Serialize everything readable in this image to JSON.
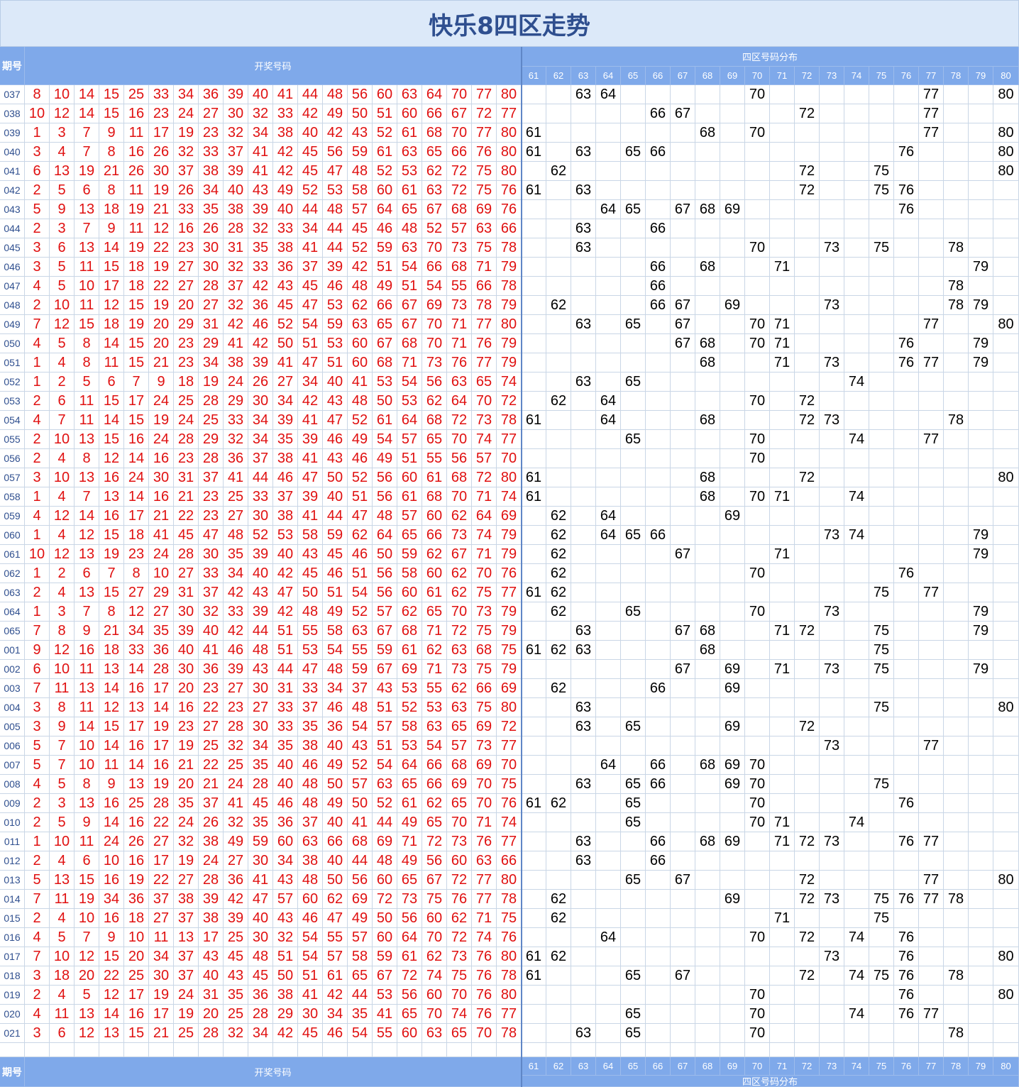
{
  "title": "快乐8四区走势",
  "header": {
    "issue_label": "期号",
    "draw_label": "开奖号码",
    "zone_label": "四区号码分布",
    "zone_numbers": [
      "61",
      "62",
      "63",
      "64",
      "65",
      "66",
      "67",
      "68",
      "69",
      "70",
      "71",
      "72",
      "73",
      "74",
      "75",
      "76",
      "77",
      "78",
      "79",
      "80"
    ]
  },
  "chart_data": {
    "type": "table",
    "columns": [
      "期号",
      "开奖号码",
      "四区号码分布"
    ],
    "rows": [
      {
        "issue": "037",
        "numbers": [
          "8",
          "10",
          "14",
          "15",
          "25",
          "33",
          "34",
          "36",
          "39",
          "40",
          "41",
          "44",
          "48",
          "56",
          "60",
          "63",
          "64",
          "70",
          "77",
          "80"
        ]
      },
      {
        "issue": "038",
        "numbers": [
          "10",
          "12",
          "14",
          "15",
          "16",
          "23",
          "24",
          "27",
          "30",
          "32",
          "33",
          "42",
          "49",
          "50",
          "51",
          "60",
          "66",
          "67",
          "72",
          "77"
        ]
      },
      {
        "issue": "039",
        "numbers": [
          "1",
          "3",
          "7",
          "9",
          "11",
          "17",
          "19",
          "23",
          "32",
          "34",
          "38",
          "40",
          "42",
          "43",
          "52",
          "61",
          "68",
          "70",
          "77",
          "80"
        ]
      },
      {
        "issue": "040",
        "numbers": [
          "3",
          "4",
          "7",
          "8",
          "16",
          "26",
          "32",
          "33",
          "37",
          "41",
          "42",
          "45",
          "56",
          "59",
          "61",
          "63",
          "65",
          "66",
          "76",
          "80"
        ]
      },
      {
        "issue": "041",
        "numbers": [
          "6",
          "13",
          "19",
          "21",
          "26",
          "30",
          "37",
          "38",
          "39",
          "41",
          "42",
          "45",
          "47",
          "48",
          "52",
          "53",
          "62",
          "72",
          "75",
          "80"
        ]
      },
      {
        "issue": "042",
        "numbers": [
          "2",
          "5",
          "6",
          "8",
          "11",
          "19",
          "26",
          "34",
          "40",
          "43",
          "49",
          "52",
          "53",
          "58",
          "60",
          "61",
          "63",
          "72",
          "75",
          "76"
        ]
      },
      {
        "issue": "043",
        "numbers": [
          "5",
          "9",
          "13",
          "18",
          "19",
          "21",
          "33",
          "35",
          "38",
          "39",
          "40",
          "44",
          "48",
          "57",
          "64",
          "65",
          "67",
          "68",
          "69",
          "76"
        ]
      },
      {
        "issue": "044",
        "numbers": [
          "2",
          "3",
          "7",
          "9",
          "11",
          "12",
          "16",
          "26",
          "28",
          "32",
          "33",
          "34",
          "44",
          "45",
          "46",
          "48",
          "52",
          "57",
          "63",
          "66"
        ]
      },
      {
        "issue": "045",
        "numbers": [
          "3",
          "6",
          "13",
          "14",
          "19",
          "22",
          "23",
          "30",
          "31",
          "35",
          "38",
          "41",
          "44",
          "52",
          "59",
          "63",
          "70",
          "73",
          "75",
          "78"
        ]
      },
      {
        "issue": "046",
        "numbers": [
          "3",
          "5",
          "11",
          "15",
          "18",
          "19",
          "27",
          "30",
          "32",
          "33",
          "36",
          "37",
          "39",
          "42",
          "51",
          "54",
          "66",
          "68",
          "71",
          "79"
        ]
      },
      {
        "issue": "047",
        "numbers": [
          "4",
          "5",
          "10",
          "17",
          "18",
          "22",
          "27",
          "28",
          "37",
          "42",
          "43",
          "45",
          "46",
          "48",
          "49",
          "51",
          "54",
          "55",
          "66",
          "78"
        ]
      },
      {
        "issue": "048",
        "numbers": [
          "2",
          "10",
          "11",
          "12",
          "15",
          "19",
          "20",
          "27",
          "32",
          "36",
          "45",
          "47",
          "53",
          "62",
          "66",
          "67",
          "69",
          "73",
          "78",
          "79"
        ]
      },
      {
        "issue": "049",
        "numbers": [
          "7",
          "12",
          "15",
          "18",
          "19",
          "20",
          "29",
          "31",
          "42",
          "46",
          "52",
          "54",
          "59",
          "63",
          "65",
          "67",
          "70",
          "71",
          "77",
          "80"
        ]
      },
      {
        "issue": "050",
        "numbers": [
          "4",
          "5",
          "8",
          "14",
          "15",
          "20",
          "23",
          "29",
          "41",
          "42",
          "50",
          "51",
          "53",
          "60",
          "67",
          "68",
          "70",
          "71",
          "76",
          "79"
        ]
      },
      {
        "issue": "051",
        "numbers": [
          "1",
          "4",
          "8",
          "11",
          "15",
          "21",
          "23",
          "34",
          "38",
          "39",
          "41",
          "47",
          "51",
          "60",
          "68",
          "71",
          "73",
          "76",
          "77",
          "79"
        ]
      },
      {
        "issue": "052",
        "numbers": [
          "1",
          "2",
          "5",
          "6",
          "7",
          "9",
          "18",
          "19",
          "24",
          "26",
          "27",
          "34",
          "40",
          "41",
          "53",
          "54",
          "56",
          "63",
          "65",
          "74"
        ]
      },
      {
        "issue": "053",
        "numbers": [
          "2",
          "6",
          "11",
          "15",
          "17",
          "24",
          "25",
          "28",
          "29",
          "30",
          "34",
          "42",
          "43",
          "48",
          "50",
          "53",
          "62",
          "64",
          "70",
          "72"
        ]
      },
      {
        "issue": "054",
        "numbers": [
          "4",
          "7",
          "11",
          "14",
          "15",
          "19",
          "24",
          "25",
          "33",
          "34",
          "39",
          "41",
          "47",
          "52",
          "61",
          "64",
          "68",
          "72",
          "73",
          "78"
        ]
      },
      {
        "issue": "055",
        "numbers": [
          "2",
          "10",
          "13",
          "15",
          "16",
          "24",
          "28",
          "29",
          "32",
          "34",
          "35",
          "39",
          "46",
          "49",
          "54",
          "57",
          "65",
          "70",
          "74",
          "77"
        ]
      },
      {
        "issue": "056",
        "numbers": [
          "2",
          "4",
          "8",
          "12",
          "14",
          "16",
          "23",
          "28",
          "36",
          "37",
          "38",
          "41",
          "43",
          "46",
          "49",
          "51",
          "55",
          "56",
          "57",
          "70"
        ]
      },
      {
        "issue": "057",
        "numbers": [
          "3",
          "10",
          "13",
          "16",
          "24",
          "30",
          "31",
          "37",
          "41",
          "44",
          "46",
          "47",
          "50",
          "52",
          "56",
          "60",
          "61",
          "68",
          "72",
          "80"
        ]
      },
      {
        "issue": "058",
        "numbers": [
          "1",
          "4",
          "7",
          "13",
          "14",
          "16",
          "21",
          "23",
          "25",
          "33",
          "37",
          "39",
          "40",
          "51",
          "56",
          "61",
          "68",
          "70",
          "71",
          "74"
        ]
      },
      {
        "issue": "059",
        "numbers": [
          "4",
          "12",
          "14",
          "16",
          "17",
          "21",
          "22",
          "23",
          "27",
          "30",
          "38",
          "41",
          "44",
          "47",
          "48",
          "57",
          "60",
          "62",
          "64",
          "69"
        ]
      },
      {
        "issue": "060",
        "numbers": [
          "1",
          "4",
          "12",
          "15",
          "18",
          "41",
          "45",
          "47",
          "48",
          "52",
          "53",
          "58",
          "59",
          "62",
          "64",
          "65",
          "66",
          "73",
          "74",
          "79"
        ]
      },
      {
        "issue": "061",
        "numbers": [
          "10",
          "12",
          "13",
          "19",
          "23",
          "24",
          "28",
          "30",
          "35",
          "39",
          "40",
          "43",
          "45",
          "46",
          "50",
          "59",
          "62",
          "67",
          "71",
          "79"
        ]
      },
      {
        "issue": "062",
        "numbers": [
          "1",
          "2",
          "6",
          "7",
          "8",
          "10",
          "27",
          "33",
          "34",
          "40",
          "42",
          "45",
          "46",
          "51",
          "56",
          "58",
          "60",
          "62",
          "70",
          "76"
        ]
      },
      {
        "issue": "063",
        "numbers": [
          "2",
          "4",
          "13",
          "15",
          "27",
          "29",
          "31",
          "37",
          "42",
          "43",
          "47",
          "50",
          "51",
          "54",
          "56",
          "60",
          "61",
          "62",
          "75",
          "77"
        ]
      },
      {
        "issue": "064",
        "numbers": [
          "1",
          "3",
          "7",
          "8",
          "12",
          "27",
          "30",
          "32",
          "33",
          "39",
          "42",
          "48",
          "49",
          "52",
          "57",
          "62",
          "65",
          "70",
          "73",
          "79"
        ]
      },
      {
        "issue": "065",
        "numbers": [
          "7",
          "8",
          "9",
          "21",
          "34",
          "35",
          "39",
          "40",
          "42",
          "44",
          "51",
          "55",
          "58",
          "63",
          "67",
          "68",
          "71",
          "72",
          "75",
          "79"
        ]
      },
      {
        "issue": "001",
        "numbers": [
          "9",
          "12",
          "16",
          "18",
          "33",
          "36",
          "40",
          "41",
          "46",
          "48",
          "51",
          "53",
          "54",
          "55",
          "59",
          "61",
          "62",
          "63",
          "68",
          "75"
        ]
      },
      {
        "issue": "002",
        "numbers": [
          "6",
          "10",
          "11",
          "13",
          "14",
          "28",
          "30",
          "36",
          "39",
          "43",
          "44",
          "47",
          "48",
          "59",
          "67",
          "69",
          "71",
          "73",
          "75",
          "79"
        ]
      },
      {
        "issue": "003",
        "numbers": [
          "7",
          "11",
          "13",
          "14",
          "16",
          "17",
          "20",
          "23",
          "27",
          "30",
          "31",
          "33",
          "34",
          "37",
          "43",
          "53",
          "55",
          "62",
          "66",
          "69"
        ]
      },
      {
        "issue": "004",
        "numbers": [
          "3",
          "8",
          "11",
          "12",
          "13",
          "14",
          "16",
          "22",
          "23",
          "27",
          "33",
          "37",
          "46",
          "48",
          "51",
          "52",
          "53",
          "63",
          "75",
          "80"
        ]
      },
      {
        "issue": "005",
        "numbers": [
          "3",
          "9",
          "14",
          "15",
          "17",
          "19",
          "23",
          "27",
          "28",
          "30",
          "33",
          "35",
          "36",
          "54",
          "57",
          "58",
          "63",
          "65",
          "69",
          "72"
        ]
      },
      {
        "issue": "006",
        "numbers": [
          "5",
          "7",
          "10",
          "14",
          "16",
          "17",
          "19",
          "25",
          "32",
          "34",
          "35",
          "38",
          "40",
          "43",
          "51",
          "53",
          "54",
          "57",
          "73",
          "77"
        ]
      },
      {
        "issue": "007",
        "numbers": [
          "5",
          "7",
          "10",
          "11",
          "14",
          "16",
          "21",
          "22",
          "25",
          "35",
          "40",
          "46",
          "49",
          "52",
          "54",
          "64",
          "66",
          "68",
          "69",
          "70"
        ]
      },
      {
        "issue": "008",
        "numbers": [
          "4",
          "5",
          "8",
          "9",
          "13",
          "19",
          "20",
          "21",
          "24",
          "28",
          "40",
          "48",
          "50",
          "57",
          "63",
          "65",
          "66",
          "69",
          "70",
          "75"
        ]
      },
      {
        "issue": "009",
        "numbers": [
          "2",
          "3",
          "13",
          "16",
          "25",
          "28",
          "35",
          "37",
          "41",
          "45",
          "46",
          "48",
          "49",
          "50",
          "52",
          "61",
          "62",
          "65",
          "70",
          "76"
        ]
      },
      {
        "issue": "010",
        "numbers": [
          "2",
          "5",
          "9",
          "14",
          "16",
          "22",
          "24",
          "26",
          "32",
          "35",
          "36",
          "37",
          "40",
          "41",
          "44",
          "49",
          "65",
          "70",
          "71",
          "74"
        ]
      },
      {
        "issue": "011",
        "numbers": [
          "1",
          "10",
          "11",
          "24",
          "26",
          "27",
          "32",
          "38",
          "49",
          "59",
          "60",
          "63",
          "66",
          "68",
          "69",
          "71",
          "72",
          "73",
          "76",
          "77"
        ]
      },
      {
        "issue": "012",
        "numbers": [
          "2",
          "4",
          "6",
          "10",
          "16",
          "17",
          "19",
          "24",
          "27",
          "30",
          "34",
          "38",
          "40",
          "44",
          "48",
          "49",
          "56",
          "60",
          "63",
          "66"
        ]
      },
      {
        "issue": "013",
        "numbers": [
          "5",
          "13",
          "15",
          "16",
          "19",
          "22",
          "27",
          "28",
          "36",
          "41",
          "43",
          "48",
          "50",
          "56",
          "60",
          "65",
          "67",
          "72",
          "77",
          "80"
        ]
      },
      {
        "issue": "014",
        "numbers": [
          "7",
          "11",
          "19",
          "34",
          "36",
          "37",
          "38",
          "39",
          "42",
          "47",
          "57",
          "60",
          "62",
          "69",
          "72",
          "73",
          "75",
          "76",
          "77",
          "78"
        ]
      },
      {
        "issue": "015",
        "numbers": [
          "2",
          "4",
          "10",
          "16",
          "18",
          "27",
          "37",
          "38",
          "39",
          "40",
          "43",
          "46",
          "47",
          "49",
          "50",
          "56",
          "60",
          "62",
          "71",
          "75"
        ]
      },
      {
        "issue": "016",
        "numbers": [
          "4",
          "5",
          "7",
          "9",
          "10",
          "11",
          "13",
          "17",
          "25",
          "30",
          "32",
          "54",
          "55",
          "57",
          "60",
          "64",
          "70",
          "72",
          "74",
          "76"
        ]
      },
      {
        "issue": "017",
        "numbers": [
          "7",
          "10",
          "12",
          "15",
          "20",
          "34",
          "37",
          "43",
          "45",
          "48",
          "51",
          "54",
          "57",
          "58",
          "59",
          "61",
          "62",
          "73",
          "76",
          "80"
        ]
      },
      {
        "issue": "018",
        "numbers": [
          "3",
          "18",
          "20",
          "22",
          "25",
          "30",
          "37",
          "40",
          "43",
          "45",
          "50",
          "51",
          "61",
          "65",
          "67",
          "72",
          "74",
          "75",
          "76",
          "78"
        ]
      },
      {
        "issue": "019",
        "numbers": [
          "2",
          "4",
          "5",
          "12",
          "17",
          "19",
          "24",
          "31",
          "35",
          "36",
          "38",
          "41",
          "42",
          "44",
          "53",
          "56",
          "60",
          "70",
          "76",
          "80"
        ]
      },
      {
        "issue": "020",
        "numbers": [
          "4",
          "11",
          "13",
          "14",
          "16",
          "17",
          "19",
          "20",
          "25",
          "28",
          "29",
          "30",
          "34",
          "35",
          "41",
          "65",
          "70",
          "74",
          "76",
          "77"
        ]
      },
      {
        "issue": "021",
        "numbers": [
          "3",
          "6",
          "12",
          "13",
          "15",
          "21",
          "25",
          "28",
          "32",
          "34",
          "42",
          "45",
          "46",
          "54",
          "55",
          "60",
          "63",
          "65",
          "70",
          "78"
        ]
      }
    ]
  }
}
